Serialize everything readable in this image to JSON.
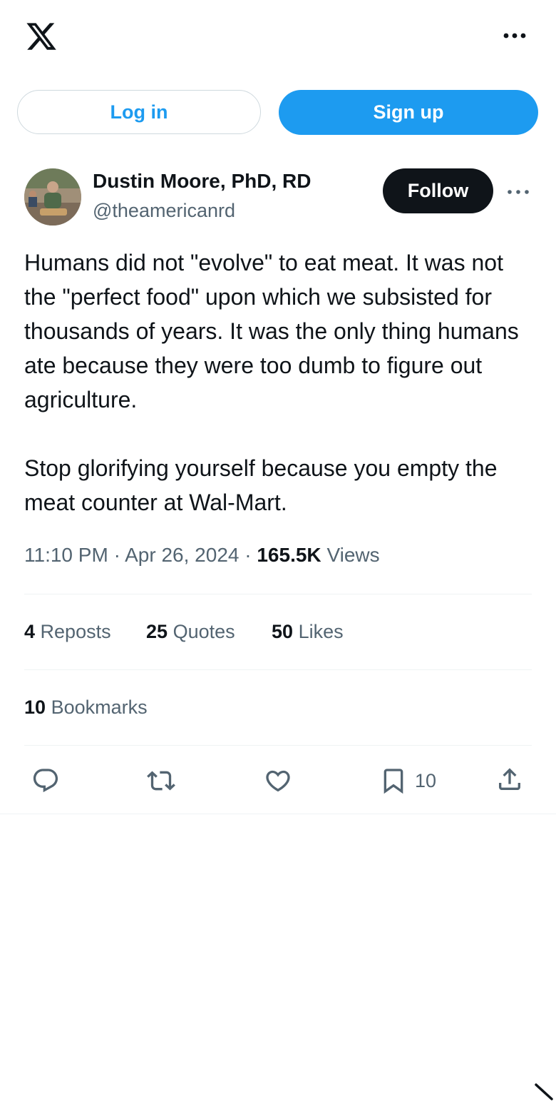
{
  "header": {
    "logo_icon": "x-logo-icon",
    "more_icon": "more-horizontal-icon"
  },
  "auth": {
    "login_label": "Log in",
    "signup_label": "Sign up"
  },
  "author": {
    "name": "Dustin Moore, PhD, RD",
    "handle": "@theamericanrd",
    "follow_label": "Follow"
  },
  "post": {
    "text": "Humans did not \"evolve\" to eat meat. It was not the \"perfect food\" upon which we subsisted for thousands of years. It was the only thing humans ate because they were too dumb to figure out agriculture.\n\nStop glorifying yourself because you empty the meat counter at Wal-Mart.",
    "time": "11:10 PM",
    "date": "Apr 26, 2024",
    "separator": "·",
    "views_count": "165.5K",
    "views_label": "Views"
  },
  "stats": {
    "reposts_count": "4",
    "reposts_label": "Reposts",
    "quotes_count": "25",
    "quotes_label": "Quotes",
    "likes_count": "50",
    "likes_label": "Likes",
    "bookmarks_count": "10",
    "bookmarks_label": "Bookmarks"
  },
  "actions": {
    "bookmark_count": "10"
  },
  "colors": {
    "accent": "#1d9bf0",
    "text_primary": "#0f1419",
    "text_secondary": "#536471",
    "divider": "#eff3f4"
  }
}
